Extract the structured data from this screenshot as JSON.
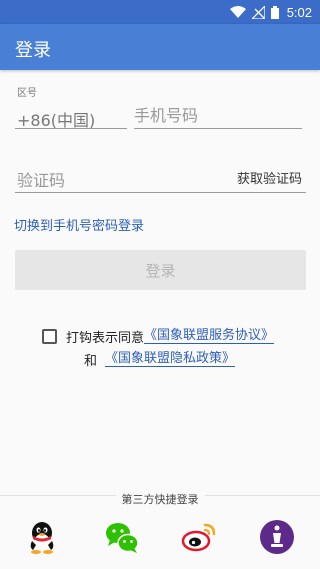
{
  "status_bar": {
    "time": "5:02"
  },
  "app_bar": {
    "title": "登录"
  },
  "phone": {
    "area_label": "区号",
    "country_code": "+86(中国)",
    "placeholder": "手机号码"
  },
  "code": {
    "placeholder": "验证码",
    "get_code_label": "获取验证码"
  },
  "switch_link": "切换到手机号密码登录",
  "login_button": "登录",
  "agreement": {
    "prefix": "打钩表示同意",
    "service_link": "《国象联盟服务协议》",
    "and": "和",
    "privacy_link": "《国象联盟隐私政策》"
  },
  "third_party": {
    "label": "第三方快捷登录",
    "providers": [
      "qq-icon",
      "wechat-icon",
      "weibo-icon",
      "chess-app-icon"
    ]
  },
  "colors": {
    "status_bar": "#3b6cc8",
    "app_bar": "#4a7fd6",
    "link": "#2e5fb8",
    "button_disabled_bg": "#e6e6e6",
    "button_disabled_text": "#b5b5b5"
  }
}
